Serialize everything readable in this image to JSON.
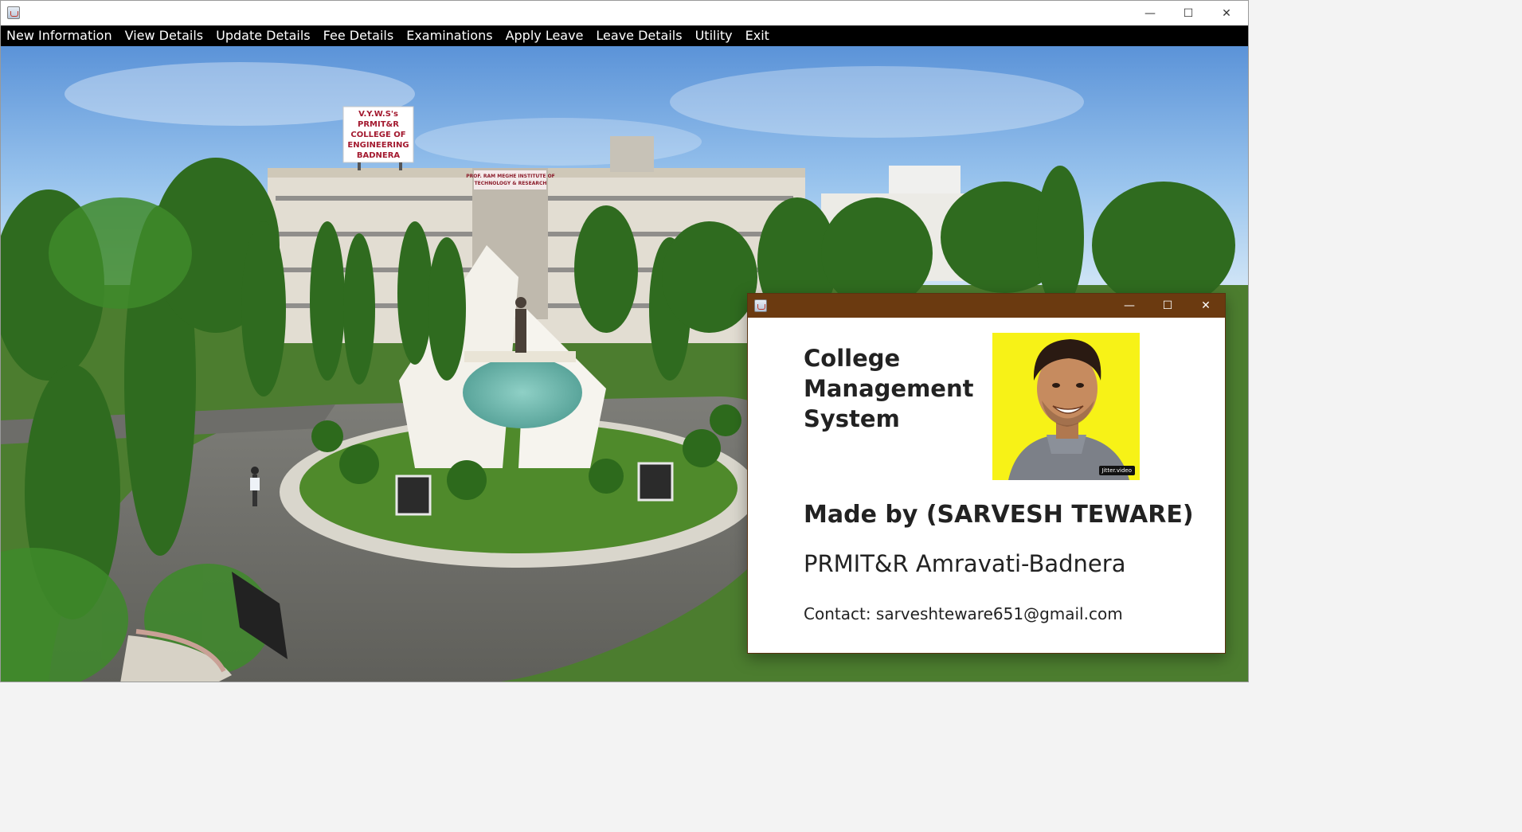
{
  "window": {
    "minimize_glyph": "—",
    "maximize_glyph": "☐",
    "close_glyph": "✕"
  },
  "menu": [
    {
      "label": "New Information"
    },
    {
      "label": "View Details"
    },
    {
      "label": "Update Details"
    },
    {
      "label": "Fee Details"
    },
    {
      "label": "Examinations"
    },
    {
      "label": "Apply Leave"
    },
    {
      "label": "Leave Details"
    },
    {
      "label": "Utility"
    },
    {
      "label": "Exit"
    }
  ],
  "background": {
    "rooftop_sign": [
      "V.Y.W.S's",
      "PRMIT&R",
      "COLLEGE OF",
      "ENGINEERING",
      "BADNERA"
    ],
    "facade_sign": [
      "PROF. RAM MEGHE INSTITUTE OF",
      "TECHNOLOGY & RESEARCH"
    ]
  },
  "about": {
    "title_line1": "College",
    "title_line2": "Management",
    "title_line3": "System",
    "made_by": "Made by (SARVESH TEWARE)",
    "college": "PRMIT&R Amravati-Badnera",
    "contact": "Contact: sarveshteware651@gmail.com",
    "photo_watermark": "Jitter.video"
  },
  "colors": {
    "menubar_bg": "#000000",
    "menu_text": "#ffffff",
    "dialog_titlebar": "#6b3a10",
    "photo_bg": "#f7f217"
  }
}
